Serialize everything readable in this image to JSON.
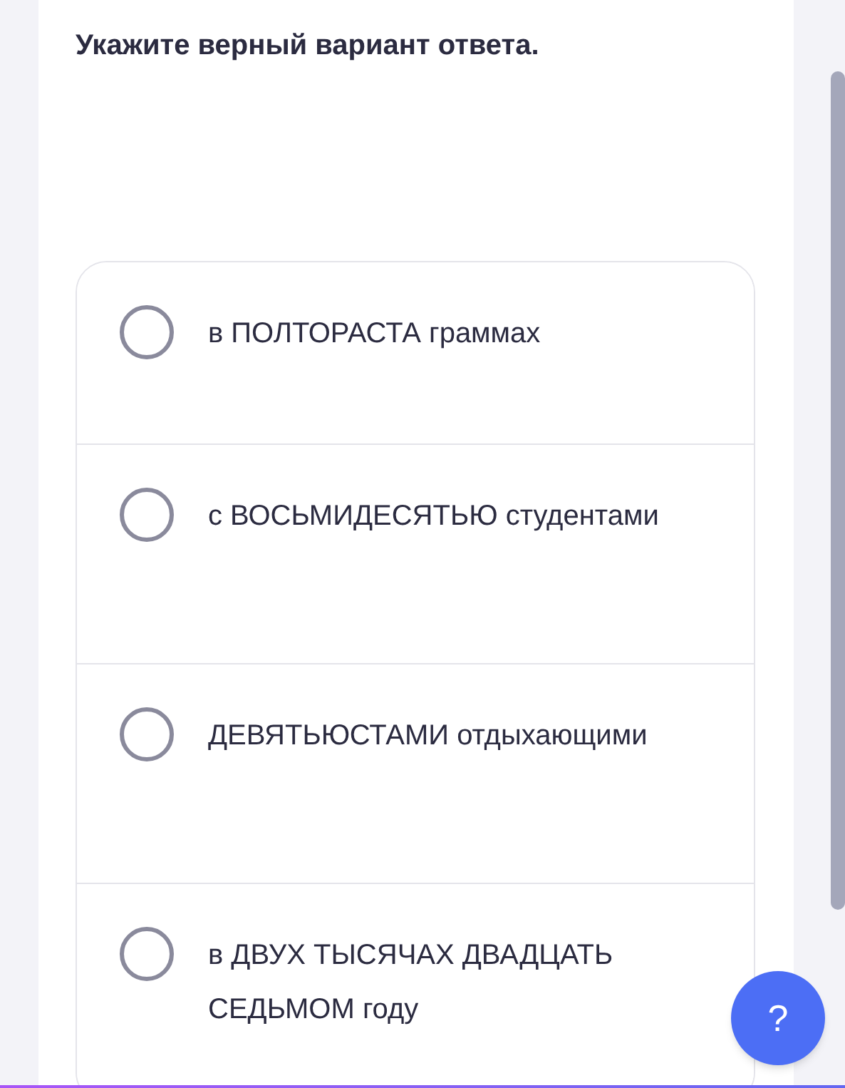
{
  "question": "Укажите верный вариант ответа.",
  "options": [
    {
      "label": "в ПОЛТОРАСТА граммах",
      "selected": false
    },
    {
      "label": "с ВОСЬМИДЕСЯТЬЮ студентами",
      "selected": false
    },
    {
      "label": "ДЕВЯТЬЮСТАМИ отдыхающими",
      "selected": false
    },
    {
      "label": "в ДВУХ ТЫСЯЧАХ ДВАДЦАТЬ СЕДЬМОМ году",
      "selected": false
    }
  ],
  "help_button": "?"
}
